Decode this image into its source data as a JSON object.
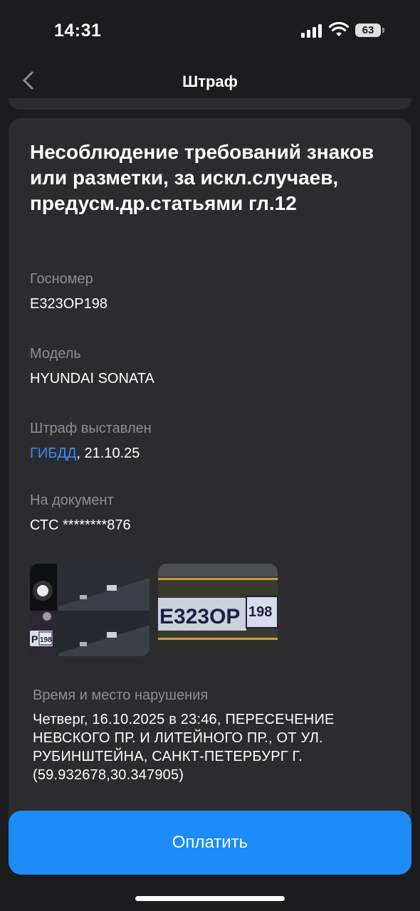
{
  "status_bar": {
    "time": "14:31",
    "battery": "63"
  },
  "nav": {
    "title": "Штраф",
    "back_icon": "chevron-left-icon"
  },
  "fine": {
    "title": "Несоблюдение требований знаков или разметки, за искл.случаев, предусм.др.статьями гл.12",
    "plate_label": "Госномер",
    "plate_value": "Е323ОР198",
    "model_label": "Модель",
    "model_value": "HYUNDAI SONATA",
    "issued_label": "Штраф выставлен",
    "issued_by": "ГИБДД",
    "issued_date": ", 21.10.25",
    "document_label": "На документ",
    "document_value": "СТС ********876",
    "photo_plate_text": "E323OP",
    "photo_region": "198",
    "violation_label": "Время и место нарушения",
    "violation_text": "Четверг, 16.10.2025 в 23:46, ПЕРЕСЕЧЕНИЕ НЕВСКОГО ПР. И ЛИТЕЙНОГО ПР., ОТ УЛ. РУБИНШТЕЙНА, САНКТ-ПЕТЕРБУРГ Г. (59.932678,30.347905)"
  },
  "pay_button": {
    "label": "Оплатить"
  },
  "colors": {
    "background": "#1c1c1e",
    "card": "#2c2c2e",
    "accent": "#1d8bf8",
    "link": "#3a8bf0"
  }
}
